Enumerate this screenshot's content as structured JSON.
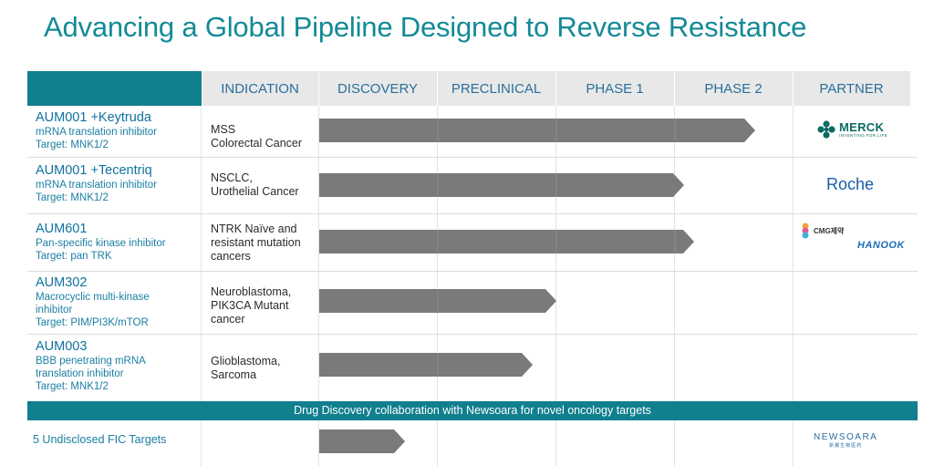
{
  "title": "Advancing a Global Pipeline Designed to Reverse Resistance",
  "columns": [
    "",
    "INDICATION",
    "DISCOVERY",
    "PRECLINICAL",
    "PHASE 1",
    "PHASE 2",
    "PARTNER"
  ],
  "programs": [
    {
      "name": "AUM001 +Keytruda",
      "desc_lines": [
        "mRNA translation inhibitor"
      ],
      "target": "Target: MNK1/2",
      "indication_lines": [
        "MSS",
        "Colorectal Cancer"
      ],
      "stage_progress": 0.92,
      "partner": {
        "logo": "merck-logo",
        "text": "MERCK",
        "sub": "INVENTING FOR LIFE"
      }
    },
    {
      "name": "AUM001 +Tecentriq",
      "desc_lines": [
        "mRNA translation inhibitor"
      ],
      "target": "Target: MNK1/2",
      "indication_lines": [
        "NSCLC,",
        "Urothelial Cancer"
      ],
      "stage_progress": 0.77,
      "partner": {
        "logo": "roche-logo",
        "text": "Roche"
      }
    },
    {
      "name": "AUM601",
      "desc_lines": [
        "Pan-specific kinase inhibitor"
      ],
      "target": "Target: pan TRK",
      "indication_lines": [
        "NTRK Naïve and",
        "resistant mutation",
        "cancers"
      ],
      "stage_progress": 0.79,
      "partner": {
        "logo": "cmg-hanook-logos",
        "text": "CMG제약",
        "text2": "HANOOK"
      }
    },
    {
      "name": "AUM302",
      "desc_lines": [
        "Macrocyclic multi-kinase",
        "inhibitor"
      ],
      "target": "Target: PIM/PI3K/mTOR",
      "indication_lines": [
        "Neuroblastoma,",
        "PIK3CA Mutant",
        "cancer"
      ],
      "stage_progress": 0.5,
      "partner": null
    },
    {
      "name": "AUM003",
      "desc_lines": [
        "BBB penetrating mRNA",
        "translation inhibitor"
      ],
      "target": "Target: MNK1/2",
      "indication_lines": [
        "Glioblastoma,",
        "Sarcoma"
      ],
      "stage_progress": 0.45,
      "partner": null
    }
  ],
  "collaboration": "Drug Discovery collaboration with Newsoara for novel oncology targets",
  "undisclosed": {
    "label": "5 Undisclosed FIC Targets",
    "stage_progress": 0.18,
    "partner": {
      "logo": "newsoara-logo",
      "text": "NEWSOARA",
      "sub": "新翼生物医药"
    }
  },
  "colors": {
    "teal": "#107f8e",
    "title": "#138a97",
    "bar": "#7a7a7a",
    "header_text": "#2a6f9a"
  }
}
